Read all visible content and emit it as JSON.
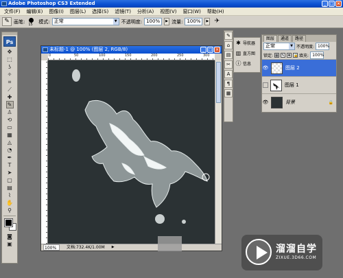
{
  "app": {
    "title": "Adobe Photoshop CS3 Extended",
    "window_controls": [
      "_",
      "□",
      "×"
    ]
  },
  "menubar": {
    "items": [
      "文件(F)",
      "编辑(E)",
      "图像(I)",
      "图层(L)",
      "选择(S)",
      "滤镜(T)",
      "分析(A)",
      "视图(V)",
      "窗口(W)",
      "帮助(H)"
    ]
  },
  "options_bar": {
    "brush_label": "画笔:",
    "brush_size": "15",
    "mode_label": "模式:",
    "mode_value": "正常",
    "opacity_label": "不透明度:",
    "opacity_value": "100%",
    "flow_label": "流量:",
    "flow_value": "100%"
  },
  "toolbox": {
    "logo": "Ps",
    "tools": [
      [
        "move-tool",
        "✥"
      ],
      [
        "marquee-tool",
        "⬚"
      ],
      [
        "lasso-tool",
        "ʖ"
      ],
      [
        "magic-wand-tool",
        "✧"
      ],
      [
        "crop-tool",
        "⌗"
      ],
      [
        "slice-tool",
        "⟋"
      ],
      [
        "healing-brush-tool",
        "✚"
      ],
      [
        "brush-tool",
        "✎"
      ],
      [
        "clone-stamp-tool",
        "♙"
      ],
      [
        "history-brush-tool",
        "⟲"
      ],
      [
        "eraser-tool",
        "▭"
      ],
      [
        "gradient-tool",
        "▦"
      ],
      [
        "blur-tool",
        "◬"
      ],
      [
        "dodge-tool",
        "◔"
      ],
      [
        "pen-tool",
        "✒"
      ],
      [
        "type-tool",
        "T"
      ],
      [
        "path-selection-tool",
        "➤"
      ],
      [
        "shape-tool",
        "▢"
      ],
      [
        "notes-tool",
        "▤"
      ],
      [
        "eyedropper-tool",
        "⌇"
      ],
      [
        "hand-tool",
        "✋"
      ],
      [
        "zoom-tool",
        "⚲"
      ]
    ]
  },
  "document": {
    "title": "未标题-1 @ 100% (图层 2, RGB/8)",
    "zoom": "100%",
    "doc_info": "文档:732.4K/1.00M",
    "ruler_numbers": [
      "0",
      "50",
      "100",
      "150",
      "200",
      "250",
      "300"
    ],
    "ruler_v_numbers": [
      "0",
      "5",
      "0",
      "1",
      "0",
      "0",
      "1",
      "5",
      "0",
      "2",
      "0",
      "0",
      "2",
      "5",
      "0"
    ],
    "canvas_color": "#2b3234"
  },
  "mini_panels": {
    "navigator": "导航器",
    "histogram": "直方图",
    "info": "信息"
  },
  "layers_panel": {
    "tabs": [
      "图层",
      "通道",
      "路径"
    ],
    "blend_mode": "正常",
    "opacity_label": "不透明度:",
    "opacity_value": "100%",
    "lock_label": "锁定:",
    "fill_label": "填充:",
    "fill_value": "100%",
    "layers": [
      {
        "name": "图层 2",
        "active": true,
        "thumb": "transparent"
      },
      {
        "name": "图层 1",
        "active": false,
        "thumb": "tree"
      },
      {
        "name": "背景",
        "active": false,
        "thumb": "dark",
        "locked": true
      }
    ]
  },
  "watermark": {
    "title": "溜溜自学",
    "url": "ZIXUE.3D66.COM"
  },
  "colors": {
    "accent": "#3a6ed8",
    "titlebar": "#0a4fd0",
    "workspace": "#6f6f6f",
    "panel": "#d4d0c8"
  }
}
